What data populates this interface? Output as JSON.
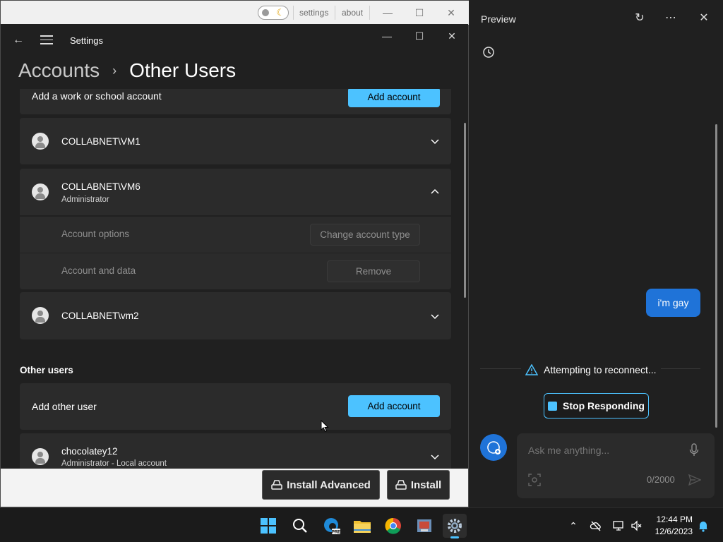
{
  "outer_window": {
    "links": [
      "settings",
      "about"
    ],
    "install_advanced_label": "Install Advanced",
    "install_label": "Install"
  },
  "settings": {
    "window_title": "Settings",
    "breadcrumb_parent": "Accounts",
    "breadcrumb_current": "Other Users",
    "work_school_label": "Add a work or school account",
    "work_school_button": "Add account",
    "users": [
      {
        "name": "COLLABNET\\VM1",
        "role": "",
        "expanded": false
      },
      {
        "name": "COLLABNET\\VM6",
        "role": "Administrator",
        "expanded": true
      },
      {
        "name": "COLLABNET\\vm2",
        "role": "",
        "expanded": false
      }
    ],
    "account_options_label": "Account options",
    "change_type_button": "Change account type",
    "account_data_label": "Account and data",
    "remove_button": "Remove",
    "other_users_heading": "Other users",
    "add_other_user_label": "Add other user",
    "add_other_user_button": "Add account",
    "local_user": {
      "name": "chocolatey12",
      "role": "Administrator - Local account"
    }
  },
  "preview": {
    "title": "Preview",
    "user_message": "i'm gay",
    "status": "Attempting to reconnect...",
    "stop_button": "Stop Responding",
    "input_placeholder": "Ask me anything...",
    "char_counter": "0/2000"
  },
  "taskbar": {
    "time": "12:44 PM",
    "date": "12/6/2023",
    "pinned": [
      "start-icon",
      "search-icon",
      "edge-icon",
      "file-explorer-icon",
      "chrome-icon",
      "installer-icon",
      "settings-gear-icon"
    ]
  },
  "colors": {
    "accent": "#4cc2ff",
    "bubble": "#1f73d8",
    "card": "#2b2b2b",
    "background": "#202020"
  }
}
